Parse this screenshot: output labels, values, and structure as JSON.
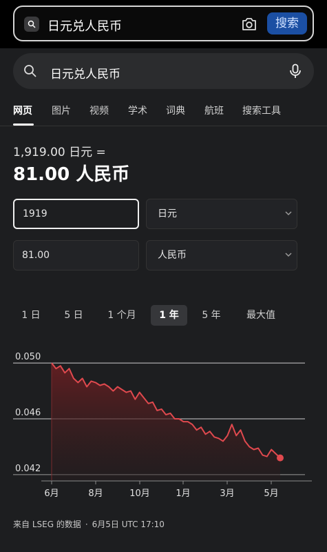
{
  "top_search": {
    "query": "日元兑人民币",
    "button_label": "搜索"
  },
  "search2": {
    "query": "日元兑人民币"
  },
  "tabs": [
    "网页",
    "图片",
    "视频",
    "学术",
    "词典",
    "航班",
    "搜索工具"
  ],
  "converter": {
    "line1": "1,919.00 日元 =",
    "line2": "81.00 人民币",
    "from_value": "1919",
    "from_currency": "日元",
    "to_value": "81.00",
    "to_currency": "人民币"
  },
  "ranges": [
    "1 日",
    "5 日",
    "1 个月",
    "1 年",
    "5 年",
    "最大值"
  ],
  "active_range": "1 年",
  "source": {
    "text": "来自 LSEG 的数据",
    "timestamp": "6月5日 UTC 17:10"
  },
  "colors": {
    "line": "#e0494e",
    "accent_button": "#1b4fa3",
    "background": "#1d1e20"
  },
  "chart_data": {
    "type": "line",
    "y_ticks": [
      "0.050",
      "0.046",
      "0.042"
    ],
    "x_ticks": [
      "6月",
      "8月",
      "10月",
      "1月",
      "3月",
      "5月"
    ],
    "ylim": [
      0.0416,
      0.0506
    ],
    "grid": true,
    "series": [
      {
        "x": [
          0,
          1,
          2,
          3,
          4,
          5,
          6,
          7,
          8,
          9,
          10,
          11,
          12,
          13,
          14,
          15,
          16,
          17,
          18,
          19,
          20,
          21,
          22,
          23,
          24,
          25,
          26,
          27,
          28,
          29,
          30,
          31,
          32,
          33,
          34,
          35,
          36,
          37,
          38,
          39,
          40,
          41,
          42,
          43,
          44,
          45,
          46,
          47,
          48,
          49,
          50,
          51,
          52
        ],
        "values": [
          0.05,
          0.0496,
          0.0498,
          0.0493,
          0.0496,
          0.0489,
          0.0486,
          0.0489,
          0.0483,
          0.0487,
          0.0486,
          0.0484,
          0.0485,
          0.0483,
          0.048,
          0.0483,
          0.0481,
          0.0479,
          0.048,
          0.0474,
          0.0479,
          0.0475,
          0.0471,
          0.0472,
          0.0466,
          0.0467,
          0.0463,
          0.0464,
          0.046,
          0.046,
          0.0458,
          0.0458,
          0.0456,
          0.0452,
          0.0454,
          0.0449,
          0.0451,
          0.0447,
          0.0446,
          0.0444,
          0.0448,
          0.0456,
          0.0448,
          0.0452,
          0.0444,
          0.044,
          0.0438,
          0.0439,
          0.0434,
          0.0433,
          0.0438,
          0.0435,
          0.0432
        ]
      }
    ]
  }
}
